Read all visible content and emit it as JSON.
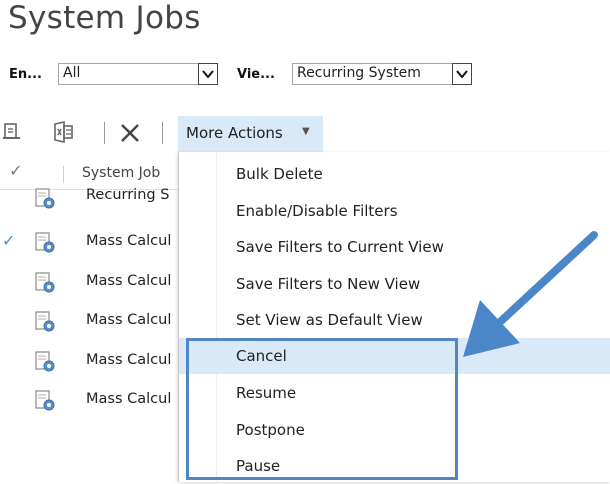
{
  "page": {
    "title": "System Jobs"
  },
  "filters": {
    "entity_label": "En...",
    "entity_value": "All",
    "view_label": "Vie...",
    "view_value": "Recurring System"
  },
  "toolbar": {
    "icons": [
      "print-icon",
      "export-icon",
      "delete-icon"
    ],
    "more_actions_label": "More Actions"
  },
  "grid": {
    "column_header": "System Job",
    "rows": [
      {
        "name": "Recurring S",
        "selected": false
      },
      {
        "name": "Mass Calcul",
        "selected": true
      },
      {
        "name": "Mass Calcul",
        "selected": false
      },
      {
        "name": "Mass Calcul",
        "selected": false
      },
      {
        "name": "Mass Calcul",
        "selected": false
      },
      {
        "name": "Mass Calcul",
        "selected": false
      }
    ]
  },
  "menu": {
    "items": [
      {
        "label": "Bulk Delete"
      },
      {
        "label": "Enable/Disable Filters"
      },
      {
        "label": "Save Filters to Current View"
      },
      {
        "label": "Save Filters to New View"
      },
      {
        "label": "Set View as Default View"
      },
      {
        "label": "Cancel",
        "hovered": true
      },
      {
        "label": "Resume"
      },
      {
        "label": "Postpone"
      },
      {
        "label": "Pause"
      }
    ]
  },
  "colors": {
    "accent_box": "#4f87c5",
    "hover_bg": "#dae9f7",
    "arrow": "#4a86c8"
  }
}
